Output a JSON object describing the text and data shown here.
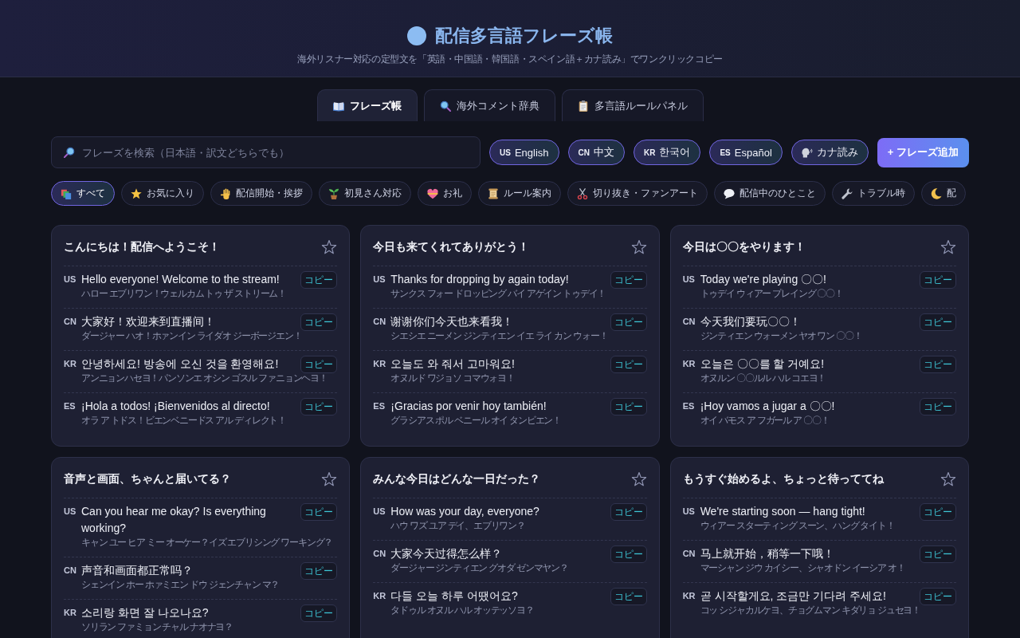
{
  "header": {
    "title": "配信多言語フレーズ帳",
    "subtitle": "海外リスナー対応の定型文を「英語・中国語・韓国語・スペイン語＋カナ読み」でワンクリックコピー"
  },
  "tabs": [
    {
      "label": "フレーズ帳",
      "selected": true
    },
    {
      "label": "海外コメント辞典",
      "selected": false
    },
    {
      "label": "多言語ルールパネル",
      "selected": false
    }
  ],
  "search": {
    "placeholder": "フレーズを検索（日本語・訳文どちらでも）"
  },
  "language_toggles": [
    {
      "kind": "language",
      "code": "US",
      "label": "English",
      "on": true
    },
    {
      "kind": "language",
      "code": "CN",
      "label": "中文",
      "on": true
    },
    {
      "kind": "language",
      "code": "KR",
      "label": "한국어",
      "on": true
    },
    {
      "kind": "language",
      "code": "ES",
      "label": "Español",
      "on": true
    },
    {
      "kind": "kana",
      "label": "カナ読み",
      "on": true
    }
  ],
  "add_button": {
    "label": "+ フレーズ追加"
  },
  "categories": [
    {
      "label": "すべて",
      "selected": true
    },
    {
      "label": "お気に入り",
      "selected": false
    },
    {
      "label": "配信開始・挨拶",
      "selected": false
    },
    {
      "label": "初見さん対応",
      "selected": false
    },
    {
      "label": "お礼",
      "selected": false
    },
    {
      "label": "ルール案内",
      "selected": false
    },
    {
      "label": "切り抜き・ファンアート",
      "selected": false
    },
    {
      "label": "配信中のひとこと",
      "selected": false
    },
    {
      "label": "トラブル時",
      "selected": false
    },
    {
      "label": "配",
      "selected": false
    }
  ],
  "cards": [
    {
      "title": "こんにちは！配信へようこそ！",
      "favorite": false,
      "phrases": [
        {
          "code": "US",
          "text": "Hello everyone! Welcome to the stream!",
          "kana": "ハロー エブリワン！ウェルカム トゥ ザ ストリーム！",
          "copy_label": "コピー"
        },
        {
          "code": "CN",
          "text": "大家好！欢迎来到直播间！",
          "kana": "ダージャー ハオ！ホァンイン ライダオ ジーボージエン！",
          "copy_label": "コピー"
        },
        {
          "code": "KR",
          "text": "안녕하세요! 방송에 오신 것을 환영해요!",
          "kana": "アンニョンハセヨ！パンソンエ オシン ゴスル ファニョンヘヨ！",
          "copy_label": "コピー"
        },
        {
          "code": "ES",
          "text": "¡Hola a todos! ¡Bienvenidos al directo!",
          "kana": "オラ ア トドス！ビエンベニードス アル ディレクト！",
          "copy_label": "コピー"
        }
      ]
    },
    {
      "title": "今日も来てくれてありがとう！",
      "favorite": false,
      "phrases": [
        {
          "code": "US",
          "text": "Thanks for dropping by again today!",
          "kana": "サンクス フォー ドロッピング バイ アゲイン トゥデイ！",
          "copy_label": "コピー"
        },
        {
          "code": "CN",
          "text": "谢谢你们今天也来看我！",
          "kana": "シエシエ ニーメン ジンティエン イエ ライ カン ウォー！",
          "copy_label": "コピー"
        },
        {
          "code": "KR",
          "text": "오늘도 와 줘서 고마워요!",
          "kana": "オヌルド ワジョソ コマウォヨ！",
          "copy_label": "コピー"
        },
        {
          "code": "ES",
          "text": "¡Gracias por venir hoy también!",
          "kana": "グラシアス ポル ベニール オイ タンビエン！",
          "copy_label": "コピー"
        }
      ]
    },
    {
      "title": "今日は〇〇をやります！",
      "favorite": false,
      "phrases": [
        {
          "code": "US",
          "text": "Today we're playing 〇〇!",
          "kana": "トゥデイ ウィアー プレイング 〇〇！",
          "copy_label": "コピー"
        },
        {
          "code": "CN",
          "text": "今天我们要玩〇〇！",
          "kana": "ジンティエン ウォーメン ヤオ ワン 〇〇！",
          "copy_label": "コピー"
        },
        {
          "code": "KR",
          "text": "오늘은 〇〇를 할 거예요!",
          "kana": "オヌルン 〇〇ルル ハル コエヨ！",
          "copy_label": "コピー"
        },
        {
          "code": "ES",
          "text": "¡Hoy vamos a jugar a 〇〇!",
          "kana": "オイ バモス ア フガール ア 〇〇！",
          "copy_label": "コピー"
        }
      ]
    },
    {
      "title": "音声と画面、ちゃんと届いてる？",
      "favorite": false,
      "phrases": [
        {
          "code": "US",
          "text": "Can you hear me okay? Is everything working?",
          "kana": "キャン ユー ヒア ミー オーケー？イズ エブリシング ワーキング？",
          "copy_label": "コピー"
        },
        {
          "code": "CN",
          "text": "声音和画面都正常吗？",
          "kana": "シェンイン ホー ホァミエン ドウ ジェンチャン マ？",
          "copy_label": "コピー"
        },
        {
          "code": "KR",
          "text": "소리랑 화면 잘 나오나요?",
          "kana": "ソリラン ファミョン チャル ナオナヨ？",
          "copy_label": "コピー"
        }
      ]
    },
    {
      "title": "みんな今日はどんな一日だった？",
      "favorite": false,
      "phrases": [
        {
          "code": "US",
          "text": "How was your day, everyone?",
          "kana": "ハウ ワズ ユア デイ、エブリワン？",
          "copy_label": "コピー"
        },
        {
          "code": "CN",
          "text": "大家今天过得怎么样？",
          "kana": "ダージャー ジンティエン グオダ ゼンマヤン？",
          "copy_label": "コピー"
        },
        {
          "code": "KR",
          "text": "다들 오늘 하루 어땠어요?",
          "kana": "タドゥル オヌル ハル オッテッソヨ？",
          "copy_label": "コピー"
        }
      ]
    },
    {
      "title": "もうすぐ始めるよ、ちょっと待っててね",
      "favorite": false,
      "phrases": [
        {
          "code": "US",
          "text": "We're starting soon — hang tight!",
          "kana": "ウィアー スターティング スーン、ハング タイト！",
          "copy_label": "コピー"
        },
        {
          "code": "CN",
          "text": "马上就开始，稍等一下哦！",
          "kana": "マーシャン ジウ カイシー、シャオドン イーシア オ！",
          "copy_label": "コピー"
        },
        {
          "code": "KR",
          "text": "곧 시작할게요, 조금만 기다려 주세요!",
          "kana": "コッ シジャカルケヨ、チョグムマン キダリョ ジュセヨ！",
          "copy_label": "コピー"
        }
      ]
    }
  ]
}
